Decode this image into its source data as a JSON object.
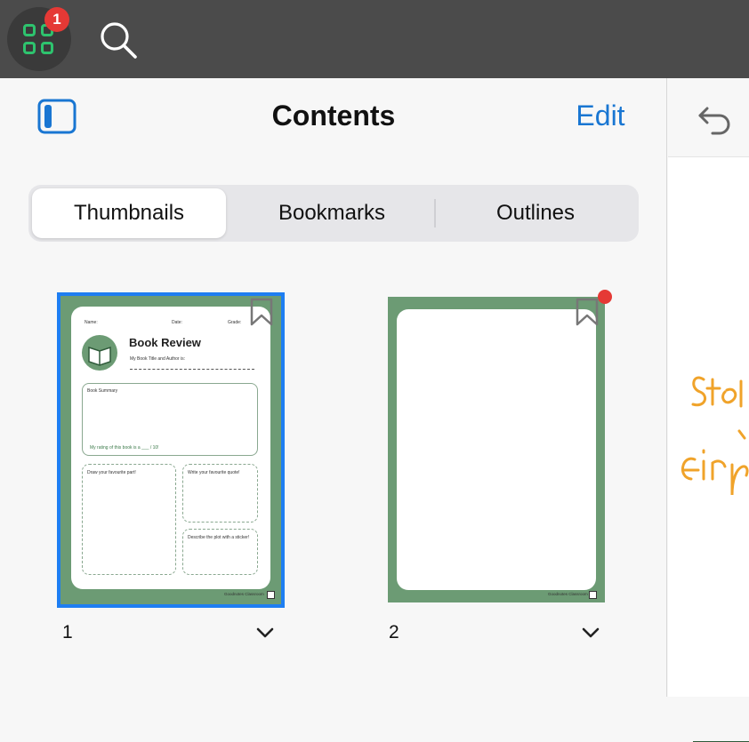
{
  "topbar": {
    "notification_count": "1"
  },
  "panel": {
    "title": "Contents",
    "edit_label": "Edit"
  },
  "tabs": [
    {
      "label": "Thumbnails",
      "active": true
    },
    {
      "label": "Bookmarks",
      "active": false
    },
    {
      "label": "Outlines",
      "active": false
    }
  ],
  "pages": [
    {
      "number": "1",
      "content": {
        "name_label": "Name:",
        "date_label": "Date:",
        "grade_label": "Grade:",
        "heading": "Book Review",
        "title_author": "My Book Title and Author is:",
        "summary": "Book Summary",
        "rating": "My rating of this book is a ___ / 10!",
        "favourite_part": "Draw your favourite part!",
        "favourite_quote": "Write your favourite quote!",
        "describe_plot": "Describe the plot with a sticker!",
        "brand": "Goodnotes Classroom"
      }
    },
    {
      "number": "2",
      "content": {
        "brand": "Goodnotes Classroom"
      }
    }
  ],
  "colors": {
    "accent": "#1976d2",
    "page_border": "#6c9b74",
    "badge": "#e53935",
    "green_icon": "#2ec36e"
  }
}
